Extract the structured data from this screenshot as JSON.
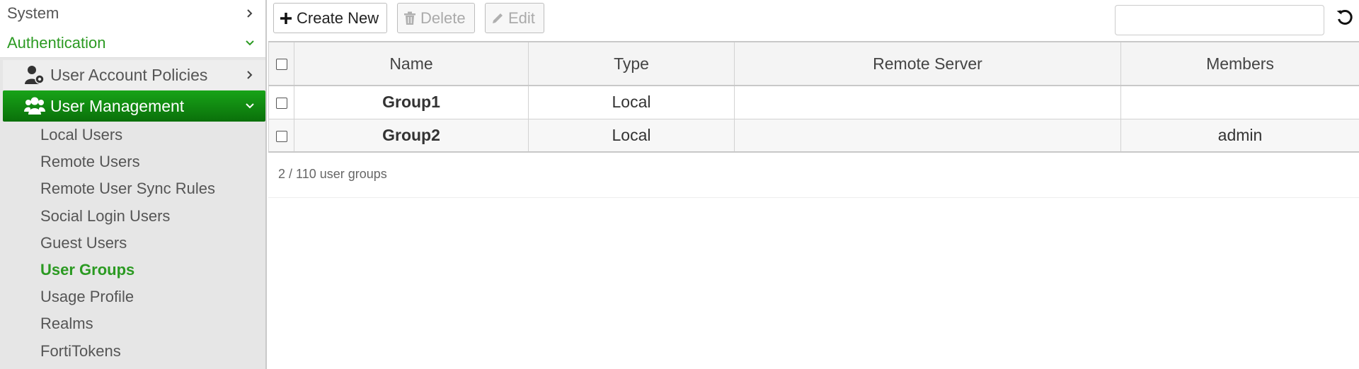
{
  "sidebar": {
    "system_label": "System",
    "authentication_label": "Authentication",
    "user_account_policies_label": "User Account Policies",
    "user_management_label": "User Management",
    "items": [
      {
        "label": "Local Users"
      },
      {
        "label": "Remote Users"
      },
      {
        "label": "Remote User Sync Rules"
      },
      {
        "label": "Social Login Users"
      },
      {
        "label": "Guest Users"
      },
      {
        "label": "User Groups"
      },
      {
        "label": "Usage Profile"
      },
      {
        "label": "Realms"
      },
      {
        "label": "FortiTokens"
      }
    ],
    "active_item": "User Groups"
  },
  "toolbar": {
    "create_label": "Create New",
    "delete_label": "Delete",
    "edit_label": "Edit",
    "search_value": "",
    "search_placeholder": ""
  },
  "table": {
    "columns": [
      "Name",
      "Type",
      "Remote Server",
      "Members"
    ],
    "rows": [
      {
        "name": "Group1",
        "type": "Local",
        "remote_server": "",
        "members": ""
      },
      {
        "name": "Group2",
        "type": "Local",
        "remote_server": "",
        "members": "admin"
      }
    ]
  },
  "footer": {
    "count_text": "2 / 110 user groups"
  },
  "colors": {
    "accent_green": "#2b9a22",
    "active_nav_bg": "#0e8a0e",
    "sidebar_bg": "#e6e6e6"
  },
  "icons": {
    "system_chevron": "chevron-right-icon",
    "authentication_chevron": "chevron-down-icon",
    "user_account_policies_icon": "user-gear-icon",
    "user_management_icon": "users-group-icon",
    "create": "plus-icon",
    "delete": "trash-icon",
    "edit": "pencil-icon",
    "refresh": "refresh-icon"
  }
}
